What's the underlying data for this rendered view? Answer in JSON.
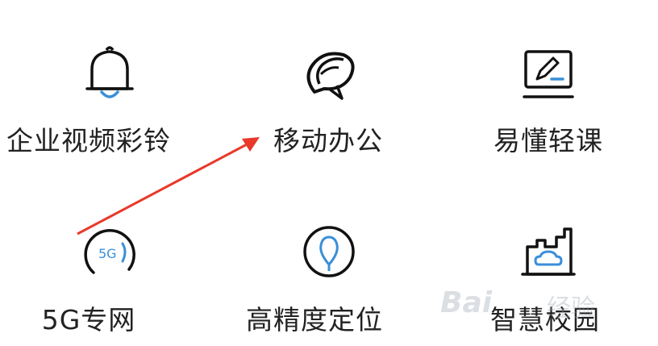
{
  "tiles": [
    {
      "label": "企业视频彩铃",
      "icon": "bell-icon"
    },
    {
      "label": "移动办公",
      "icon": "mobile-office-icon"
    },
    {
      "label": "易懂轻课",
      "icon": "monitor-edit-icon"
    },
    {
      "label": "5G专网",
      "icon": "5g-icon",
      "icon_text": "5G"
    },
    {
      "label": "高精度定位",
      "icon": "location-pin-icon"
    },
    {
      "label": "智慧校园",
      "icon": "factory-cloud-icon"
    }
  ],
  "colors": {
    "text": "#222222",
    "icon_stroke": "#111111",
    "icon_accent": "#3a8fd8",
    "annotation_arrow": "#e8392a"
  },
  "watermark": {
    "brand": "Bai",
    "text": "经验"
  }
}
